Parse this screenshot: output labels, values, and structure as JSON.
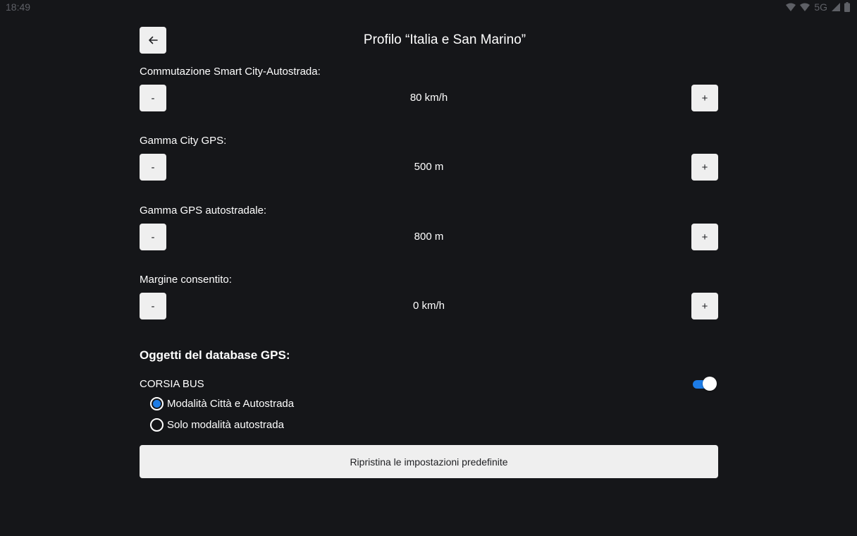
{
  "status_bar": {
    "time": "18:49",
    "network": "5G",
    "icons": [
      "wifi-icon",
      "wifi-icon",
      "signal-icon",
      "battery-icon"
    ]
  },
  "header": {
    "back_icon": "arrow-left-icon",
    "title": "Profilo “Italia e San Marino”"
  },
  "settings": [
    {
      "label": "Commutazione Smart City-Autostrada:",
      "value": "80 km/h",
      "minus": "-",
      "plus": "+"
    },
    {
      "label": "Gamma City GPS:",
      "value": "500 m",
      "minus": "-",
      "plus": "+"
    },
    {
      "label": "Gamma GPS autostradale:",
      "value": "800 m",
      "minus": "-",
      "plus": "+"
    },
    {
      "label": "Margine consentito:",
      "value": "0 km/h",
      "minus": "-",
      "plus": "+"
    }
  ],
  "database": {
    "title": "Oggetti del database GPS:",
    "item": {
      "label": "CORSIA BUS",
      "enabled": true,
      "modes": [
        {
          "label": "Modalità Città e Autostrada",
          "selected": true
        },
        {
          "label": "Solo modalità autostrada",
          "selected": false
        }
      ]
    }
  },
  "reset_label": "Ripristina le impostazioni predefinite",
  "colors": {
    "background": "#151619",
    "accent": "#1d7ce6",
    "button": "#efefef"
  }
}
